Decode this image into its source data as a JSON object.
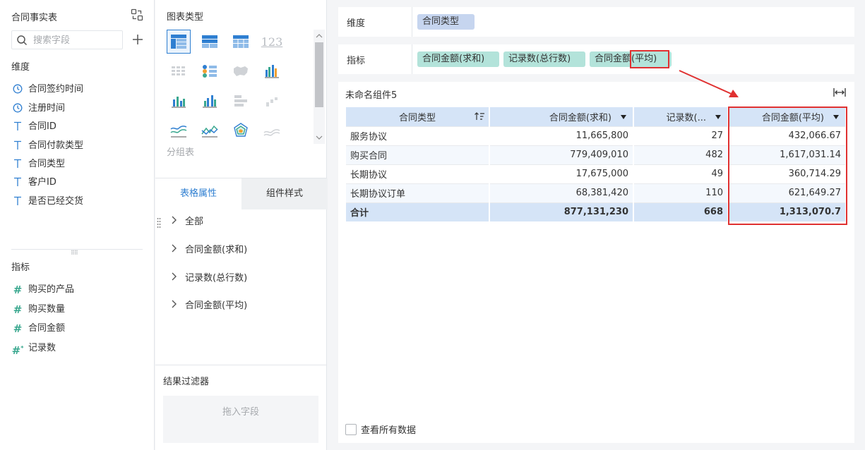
{
  "left_panel": {
    "title": "合同事实表",
    "search_placeholder": "搜索字段",
    "dimensions_label": "维度",
    "dimension_fields": [
      {
        "label": "合同签约时间",
        "icon": "clock-icon"
      },
      {
        "label": "注册时间",
        "icon": "clock-icon"
      },
      {
        "label": "合同ID",
        "icon": "text-icon"
      },
      {
        "label": "合同付款类型",
        "icon": "text-icon"
      },
      {
        "label": "合同类型",
        "icon": "text-icon"
      },
      {
        "label": "客户ID",
        "icon": "text-icon"
      },
      {
        "label": "是否已经交货",
        "icon": "text-icon"
      }
    ],
    "measures_label": "指标",
    "measure_fields": [
      {
        "label": "购买的产品",
        "icon": "hash-icon"
      },
      {
        "label": "购买数量",
        "icon": "hash-icon"
      },
      {
        "label": "合同金额",
        "icon": "hash-icon"
      },
      {
        "label": "记录数",
        "icon": "hash-star-icon"
      }
    ]
  },
  "middle_panel": {
    "chart_types_title": "图表类型",
    "group_table_label": "分组表",
    "tabs": {
      "table_props": "表格属性",
      "component_style": "组件样式"
    },
    "properties": [
      "全部",
      "合同金额(求和)",
      "记录数(总行数)",
      "合同金额(平均)"
    ],
    "filter_title": "结果过滤器",
    "filter_drop_hint": "拖入字段"
  },
  "shelves": {
    "dimension_label": "维度",
    "dimension_pills": [
      "合同类型"
    ],
    "measure_label": "指标",
    "measure_pills": [
      "合同金额(求和)",
      "记录数(总行数)",
      "合同金额(平均)"
    ]
  },
  "component": {
    "title": "未命名组件5",
    "view_all_label": "查看所有数据",
    "table": {
      "headers": [
        "合同类型",
        "合同金额(求和)",
        "记录数(...",
        "合同金额(平均)"
      ],
      "rows": [
        [
          "服务协议",
          "11,665,800",
          "27",
          "432,066.67"
        ],
        [
          "购买合同",
          "779,409,010",
          "482",
          "1,617,031.14"
        ],
        [
          "长期协议",
          "17,675,000",
          "49",
          "360,714.29"
        ],
        [
          "长期协议订单",
          "68,381,420",
          "110",
          "621,649.27"
        ]
      ],
      "total": [
        "合计",
        "877,131,230",
        "668",
        "1,313,070.7"
      ]
    }
  },
  "colors": {
    "accent": "#2f7fd1",
    "highlight": "#e03131",
    "dimension_pill": "#c6d5ef",
    "measure_pill": "#b3e3da",
    "header_bg": "#d5e4f7"
  }
}
